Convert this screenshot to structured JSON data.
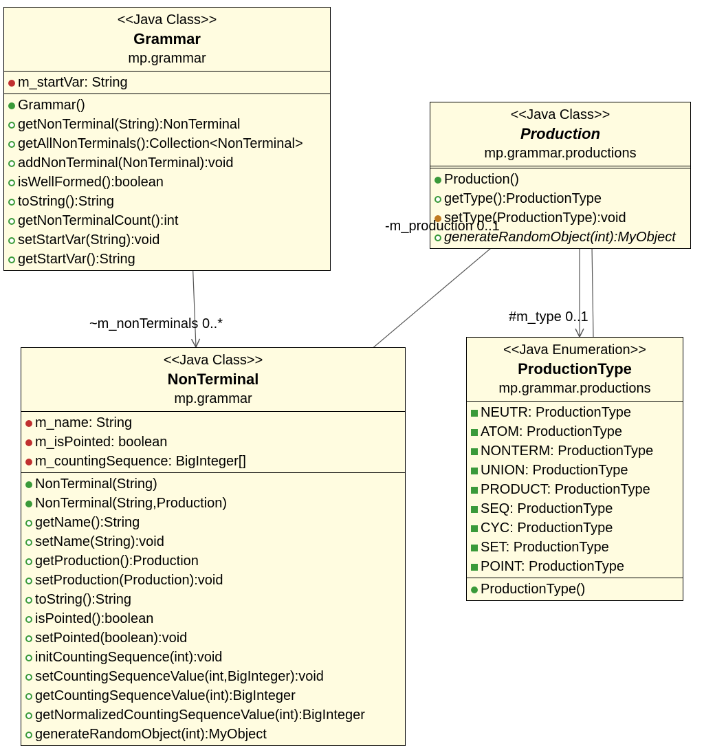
{
  "classes": {
    "grammar": {
      "stereotype": "<<Java Class>>",
      "name": "Grammar",
      "package": "mp.grammar",
      "attributes": [
        {
          "icon": "red",
          "text": "m_startVar: String"
        }
      ],
      "operations": [
        {
          "icon": "green",
          "text": "Grammar()"
        },
        {
          "icon": "green-ring",
          "text": "getNonTerminal(String):NonTerminal"
        },
        {
          "icon": "green-ring",
          "text": "getAllNonTerminals():Collection<NonTerminal>"
        },
        {
          "icon": "green-ring",
          "text": "addNonTerminal(NonTerminal):void"
        },
        {
          "icon": "green-ring",
          "text": "isWellFormed():boolean"
        },
        {
          "icon": "green-ring",
          "text": "toString():String"
        },
        {
          "icon": "green-ring",
          "text": "getNonTerminalCount():int"
        },
        {
          "icon": "green-ring",
          "text": "setStartVar(String):void"
        },
        {
          "icon": "green-ring",
          "text": "getStartVar():String"
        }
      ]
    },
    "production": {
      "stereotype": "<<Java Class>>",
      "name": "Production",
      "package": "mp.grammar.productions",
      "operations": [
        {
          "icon": "green",
          "text": "Production()"
        },
        {
          "icon": "green-ring",
          "text": "getType():ProductionType"
        },
        {
          "icon": "orange",
          "text": "setType(ProductionType):void"
        },
        {
          "icon": "green-ring",
          "text": "generateRandomObject(int):MyObject",
          "italic": true
        }
      ]
    },
    "nonterminal": {
      "stereotype": "<<Java Class>>",
      "name": "NonTerminal",
      "package": "mp.grammar",
      "attributes": [
        {
          "icon": "red",
          "text": "m_name: String"
        },
        {
          "icon": "red",
          "text": "m_isPointed: boolean"
        },
        {
          "icon": "red",
          "text": "m_countingSequence: BigInteger[]"
        }
      ],
      "operations": [
        {
          "icon": "green",
          "text": "NonTerminal(String)"
        },
        {
          "icon": "green",
          "text": "NonTerminal(String,Production)"
        },
        {
          "icon": "green-ring",
          "text": "getName():String"
        },
        {
          "icon": "green-ring",
          "text": "setName(String):void"
        },
        {
          "icon": "green-ring",
          "text": "getProduction():Production"
        },
        {
          "icon": "green-ring",
          "text": "setProduction(Production):void"
        },
        {
          "icon": "green-ring",
          "text": "toString():String"
        },
        {
          "icon": "green-ring",
          "text": "isPointed():boolean"
        },
        {
          "icon": "green-ring",
          "text": "setPointed(boolean):void"
        },
        {
          "icon": "green-ring",
          "text": "initCountingSequence(int):void"
        },
        {
          "icon": "green-ring",
          "text": "setCountingSequenceValue(int,BigInteger):void"
        },
        {
          "icon": "green-ring",
          "text": "getCountingSequenceValue(int):BigInteger"
        },
        {
          "icon": "green-ring",
          "text": "getNormalizedCountingSequenceValue(int):BigInteger"
        },
        {
          "icon": "green-ring",
          "text": "generateRandomObject(int):MyObject"
        }
      ]
    },
    "productiontype": {
      "stereotype": "<<Java Enumeration>>",
      "name": "ProductionType",
      "package": "mp.grammar.productions",
      "literals": [
        {
          "icon": "green-sq",
          "text": "NEUTR: ProductionType"
        },
        {
          "icon": "green-sq",
          "text": "ATOM: ProductionType"
        },
        {
          "icon": "green-sq",
          "text": "NONTERM: ProductionType"
        },
        {
          "icon": "green-sq",
          "text": "UNION: ProductionType"
        },
        {
          "icon": "green-sq",
          "text": "PRODUCT: ProductionType"
        },
        {
          "icon": "green-sq",
          "text": "SEQ: ProductionType"
        },
        {
          "icon": "green-sq",
          "text": "CYC: ProductionType"
        },
        {
          "icon": "green-sq",
          "text": "SET: ProductionType"
        },
        {
          "icon": "green-sq",
          "text": "POINT: ProductionType"
        }
      ],
      "operations": [
        {
          "icon": "green",
          "text": "ProductionType()"
        }
      ]
    }
  },
  "associations": {
    "grammar_nonterminal": "~m_nonTerminals  0..*",
    "nonterminal_production": "-m_production  0..1",
    "production_type": "#m_type  0..1"
  }
}
